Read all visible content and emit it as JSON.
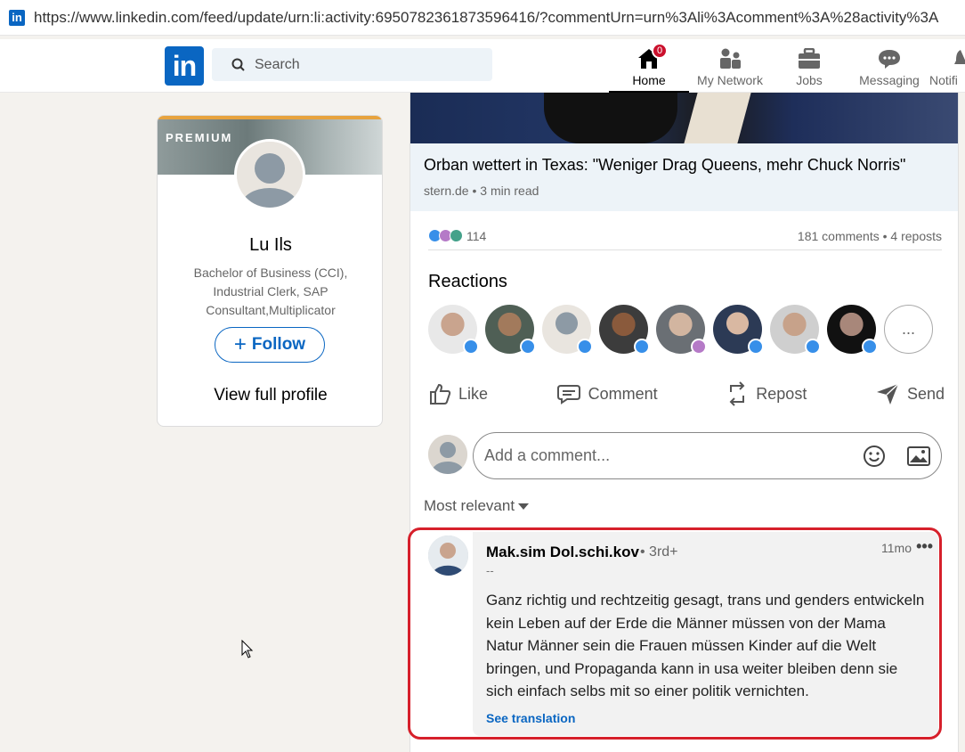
{
  "browser": {
    "url": "https://www.linkedin.com/feed/update/urn:li:activity:6950782361873596416/?commentUrn=urn%3Ali%3Acomment%3A%28activity%3A"
  },
  "nav": {
    "logo": "in",
    "search_placeholder": "Search",
    "items": [
      {
        "label": "Home",
        "badge": "0",
        "icon": "home-icon"
      },
      {
        "label": "My Network",
        "icon": "network-icon"
      },
      {
        "label": "Jobs",
        "icon": "briefcase-icon"
      },
      {
        "label": "Messaging",
        "icon": "messaging-icon"
      },
      {
        "label": "Notifi",
        "icon": "bell-icon"
      }
    ]
  },
  "profile": {
    "premium_label": "PREMIUM",
    "name": "Lu Ils",
    "headline": "Bachelor of Business (CCI), Industrial Clerk, SAP Consultant,Multiplicator",
    "follow_label": "Follow",
    "view_profile_label": "View full profile"
  },
  "post": {
    "article_title": "Orban wettert in Texas: \"Weniger Drag Queens, mehr Chuck Norris\"",
    "article_source": "stern.de • 3 min read",
    "reaction_count": "114",
    "comments_reposts": "181 comments • 4 reposts",
    "reactions_title": "Reactions",
    "reactors_more": "...",
    "actions": {
      "like": "Like",
      "comment": "Comment",
      "repost": "Repost",
      "send": "Send"
    },
    "comment_placeholder": "Add a comment...",
    "sort_label": "Most relevant"
  },
  "comment": {
    "author": "Mak.sim Dol.schi.kov",
    "degree": "• 3rd+",
    "subtitle": "--",
    "time": "11mo",
    "more": "•••",
    "body": "Ganz richtig und rechtzeitig gesagt, trans und genders entwickeln kein Leben auf der Erde die Männer müssen von der Mama Natur Männer sein die Frauen müssen Kinder auf die Welt bringen, und Propaganda kann in usa weiter bleiben denn sie sich einfach selbs mit so einer politik vernichten.",
    "translate_label": "See translation"
  },
  "colors": {
    "brand": "#0a66c2",
    "highlight_border": "#d6202b",
    "badge": "#cb112d"
  }
}
